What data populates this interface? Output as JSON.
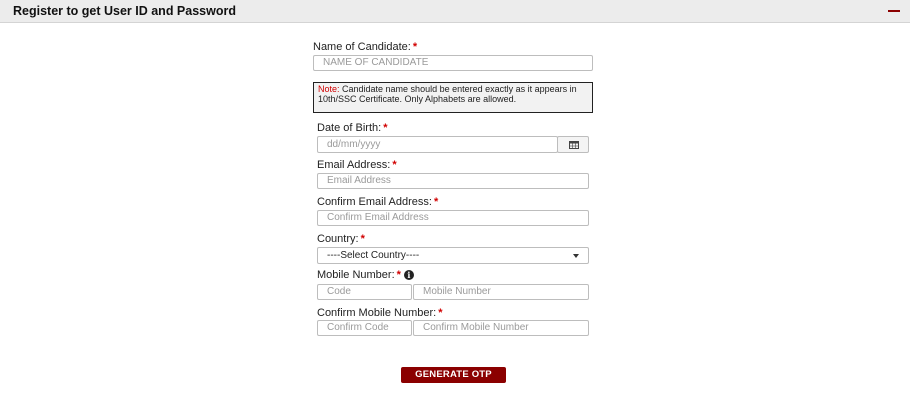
{
  "panel": {
    "title": "Register to get User ID and Password"
  },
  "form": {
    "candidate_name": {
      "label": "Name of Candidate:",
      "required": "*",
      "placeholder": "NAME OF CANDIDATE"
    },
    "note": {
      "label": "Note:",
      "text": " Candidate name should be entered exactly as it appears in 10th/SSC Certificate. Only Alphabets are allowed."
    },
    "dob": {
      "label": "Date of Birth:",
      "required": "*",
      "placeholder": "dd/mm/yyyy",
      "icon": "calendar-icon"
    },
    "email": {
      "label": "Email Address:",
      "required": "*",
      "placeholder": "Email Address"
    },
    "confirm_email": {
      "label": "Confirm Email Address:",
      "required": "*",
      "placeholder": "Confirm Email Address"
    },
    "country": {
      "label": "Country:",
      "required": "*",
      "selected": "----Select Country----"
    },
    "mobile": {
      "label": "Mobile Number:",
      "required": "*",
      "info_icon": "i",
      "code_placeholder": "Code",
      "number_placeholder": "Mobile Number"
    },
    "confirm_mobile": {
      "label": "Confirm Mobile Number:",
      "required": "*",
      "code_placeholder": "Confirm Code",
      "number_placeholder": "Confirm Mobile Number"
    },
    "submit_label": "GENERATE OTP"
  },
  "colors": {
    "accent": "#8b0000",
    "required": "#d10000",
    "header_bg": "#ececec"
  }
}
